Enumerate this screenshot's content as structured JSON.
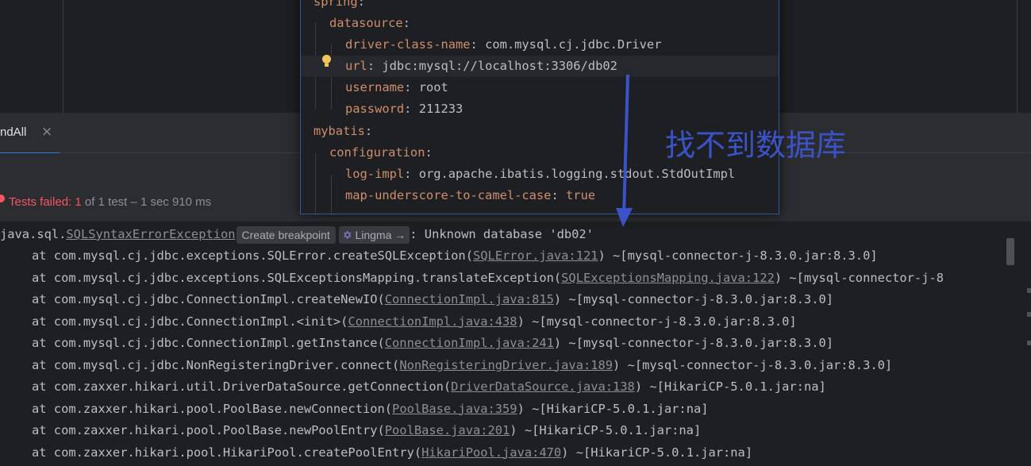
{
  "tab": {
    "label": "ndAll",
    "close": "×"
  },
  "status": {
    "prefix": "Tests failed:",
    "count": "1",
    "rest": "of 1 test – 1 sec 910 ms"
  },
  "yaml": [
    {
      "key": "spring",
      "sep": ":",
      "value": ""
    },
    {
      "key": "datasource",
      "sep": ":",
      "value": ""
    },
    {
      "key": "driver-class-name",
      "sep": ":",
      "value": " com.mysql.cj.jdbc.Driver"
    },
    {
      "key": "url",
      "sep": ":",
      "value": " jdbc:mysql://localhost:3306/db02"
    },
    {
      "key": "username",
      "sep": ":",
      "value": " root"
    },
    {
      "key": "password",
      "sep": ":",
      "value": " 211233"
    },
    {
      "key": "mybatis",
      "sep": ":",
      "value": ""
    },
    {
      "key": "configuration",
      "sep": ":",
      "value": ""
    },
    {
      "key": "log-impl",
      "sep": ":",
      "value": " org.apache.ibatis.logging.stdout.StdOutImpl"
    },
    {
      "key": "map-underscore-to-camel-case",
      "sep": ":",
      "value": " true"
    }
  ],
  "annotation": "找不到数据库",
  "console": {
    "exception": {
      "prefix": "java.sql.",
      "link": "SQLSyntaxErrorException",
      "create_breakpoint": "Create breakpoint",
      "lingma": "Lingma →",
      "message": ": Unknown database 'db02'"
    },
    "frames": [
      {
        "method": "at com.mysql.cj.jdbc.exceptions.SQLError.createSQLException(",
        "link": "SQLError.java:121",
        "suffix": ") ~[mysql-connector-j-8.3.0.jar:8.3.0]"
      },
      {
        "method": "at com.mysql.cj.jdbc.exceptions.SQLExceptionsMapping.translateException(",
        "link": "SQLExceptionsMapping.java:122",
        "suffix": ") ~[mysql-connector-j-8"
      },
      {
        "method": "at com.mysql.cj.jdbc.ConnectionImpl.createNewIO(",
        "link": "ConnectionImpl.java:815",
        "suffix": ") ~[mysql-connector-j-8.3.0.jar:8.3.0]"
      },
      {
        "method": "at com.mysql.cj.jdbc.ConnectionImpl.<init>(",
        "link": "ConnectionImpl.java:438",
        "suffix": ") ~[mysql-connector-j-8.3.0.jar:8.3.0]"
      },
      {
        "method": "at com.mysql.cj.jdbc.ConnectionImpl.getInstance(",
        "link": "ConnectionImpl.java:241",
        "suffix": ") ~[mysql-connector-j-8.3.0.jar:8.3.0]"
      },
      {
        "method": "at com.mysql.cj.jdbc.NonRegisteringDriver.connect(",
        "link": "NonRegisteringDriver.java:189",
        "suffix": ") ~[mysql-connector-j-8.3.0.jar:8.3.0]"
      },
      {
        "method": "at com.zaxxer.hikari.util.DriverDataSource.getConnection(",
        "link": "DriverDataSource.java:138",
        "suffix": ") ~[HikariCP-5.0.1.jar:na]"
      },
      {
        "method": "at com.zaxxer.hikari.pool.PoolBase.newConnection(",
        "link": "PoolBase.java:359",
        "suffix": ") ~[HikariCP-5.0.1.jar:na]"
      },
      {
        "method": "at com.zaxxer.hikari.pool.PoolBase.newPoolEntry(",
        "link": "PoolBase.java:201",
        "suffix": ") ~[HikariCP-5.0.1.jar:na]"
      },
      {
        "method": "at com.zaxxer.hikari.pool.HikariPool.createPoolEntry(",
        "link": "HikariPool.java:470",
        "suffix": ") ~[HikariCP-5.0.1.jar:na]"
      }
    ]
  },
  "colors": {
    "fail": "#f75464",
    "yaml_key": "#cf8e6d",
    "annotation": "#3b53c7",
    "panel_border": "#2f5d9c"
  }
}
